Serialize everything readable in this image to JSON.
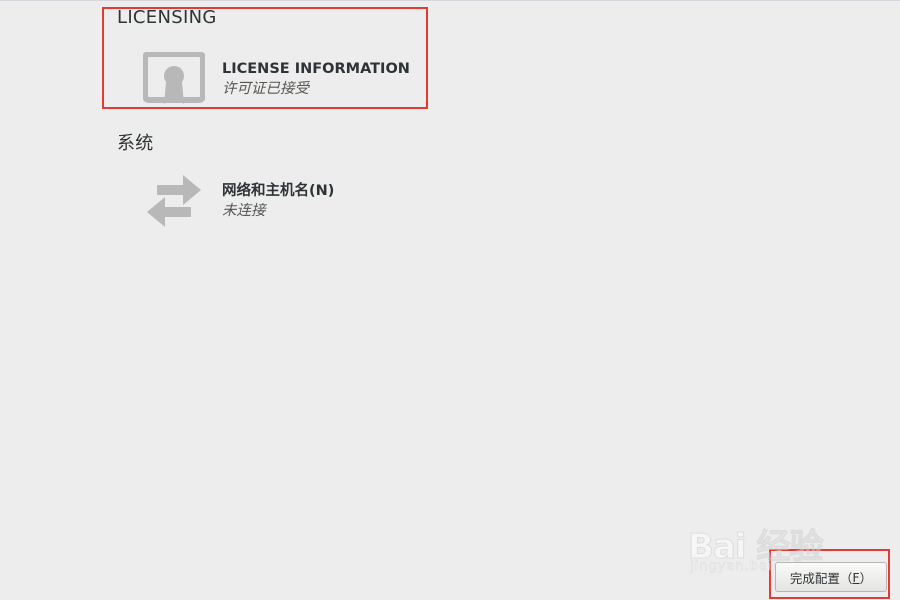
{
  "sections": [
    {
      "title": "LICENSING",
      "spokes": [
        {
          "icon": "license-certificate-icon",
          "title": "LICENSE INFORMATION",
          "status": "许可证已接受"
        }
      ]
    },
    {
      "title": "系统",
      "spokes": [
        {
          "icon": "network-arrows-icon",
          "title": "网络和主机名(N)",
          "status": "未连接"
        }
      ]
    }
  ],
  "footer": {
    "finish_label_prefix": "完成配置（",
    "finish_mnemonic": "F",
    "finish_label_suffix": "）"
  },
  "watermark": {
    "logo_text": "Bai 经验",
    "sub_text": "jingyan.baidu.com"
  },
  "colors": {
    "background": "#ededed",
    "highlight": "#e53935",
    "icon_gray": "#b8b8b8"
  }
}
